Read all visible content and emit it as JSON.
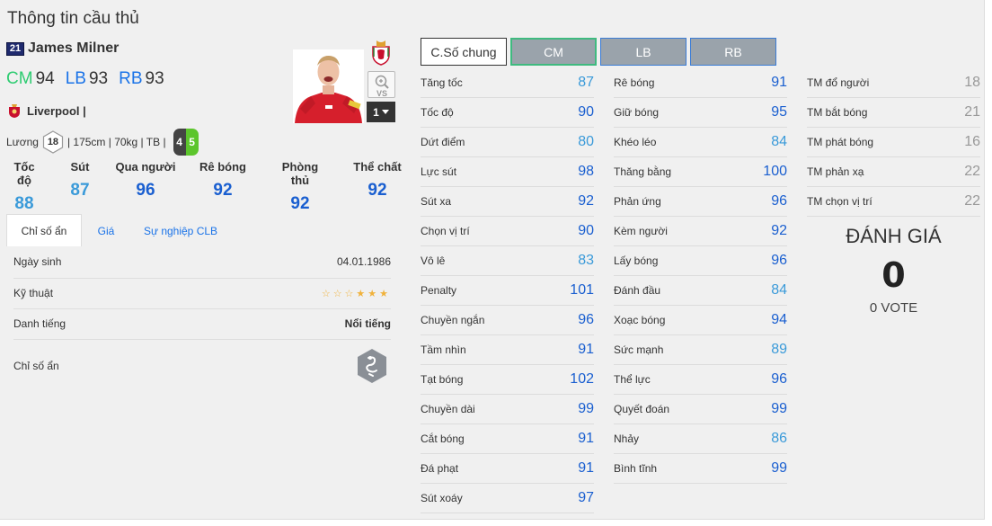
{
  "title": "Thông tin cầu thủ",
  "player": {
    "season": "21",
    "name": "James Milner",
    "positions": [
      {
        "label": "CM",
        "value": "94",
        "color": "#2ecc71"
      },
      {
        "label": "LB",
        "value": "93",
        "color": "#1a73e8"
      },
      {
        "label": "RB",
        "value": "93",
        "color": "#1a73e8"
      }
    ],
    "club": "Liverpool |",
    "salary_label": "Lương",
    "salary": "18",
    "physical": "| 175cm | 70kg | TB |",
    "foot_left": "4",
    "foot_right": "5",
    "level": "1"
  },
  "main_stats": [
    {
      "label": "Tốc độ",
      "value": "88",
      "color": "#3a9ad9"
    },
    {
      "label": "Sút",
      "value": "87",
      "color": "#3a9ad9"
    },
    {
      "label": "Qua người",
      "value": "96",
      "color": "#1a5fd0"
    },
    {
      "label": "Rê bóng",
      "value": "92",
      "color": "#1a5fd0"
    },
    {
      "label": "Phòng thủ",
      "value": "92",
      "color": "#1a5fd0"
    },
    {
      "label": "Thể chất",
      "value": "92",
      "color": "#1a5fd0"
    }
  ],
  "tabs": [
    "Chỉ số ẩn",
    "Giá",
    "Sự nghiệp CLB"
  ],
  "details": {
    "birth_label": "Ngày sinh",
    "birth_value": "04.01.1986",
    "skill_label": "Kỹ thuật",
    "skill_stars": "☆☆☆★★★",
    "fame_label": "Danh tiếng",
    "fame_value": "Nổi tiếng",
    "hidden_label": "Chỉ số ẩn"
  },
  "position_tabs": [
    "C.Số chung",
    "CM",
    "LB",
    "RB"
  ],
  "stats_col1": [
    {
      "label": "Tăng tốc",
      "value": "87",
      "color": "#3a9ad9"
    },
    {
      "label": "Tốc độ",
      "value": "90",
      "color": "#1a5fd0"
    },
    {
      "label": "Dứt điểm",
      "value": "80",
      "color": "#3a9ad9"
    },
    {
      "label": "Lực sút",
      "value": "98",
      "color": "#1a5fd0"
    },
    {
      "label": "Sút xa",
      "value": "92",
      "color": "#1a5fd0"
    },
    {
      "label": "Chọn vị trí",
      "value": "90",
      "color": "#1a5fd0"
    },
    {
      "label": "Vô lê",
      "value": "83",
      "color": "#3a9ad9"
    },
    {
      "label": "Penalty",
      "value": "101",
      "color": "#1a5fd0"
    },
    {
      "label": "Chuyền ngắn",
      "value": "96",
      "color": "#1a5fd0"
    },
    {
      "label": "Tầm nhìn",
      "value": "91",
      "color": "#1a5fd0"
    },
    {
      "label": "Tạt bóng",
      "value": "102",
      "color": "#1a5fd0"
    },
    {
      "label": "Chuyền dài",
      "value": "99",
      "color": "#1a5fd0"
    },
    {
      "label": "Cắt bóng",
      "value": "91",
      "color": "#1a5fd0"
    },
    {
      "label": "Đá phạt",
      "value": "91",
      "color": "#1a5fd0"
    },
    {
      "label": "Sút xoáy",
      "value": "97",
      "color": "#1a5fd0"
    }
  ],
  "stats_col2": [
    {
      "label": "Rê bóng",
      "value": "91",
      "color": "#1a5fd0"
    },
    {
      "label": "Giữ bóng",
      "value": "95",
      "color": "#1a5fd0"
    },
    {
      "label": "Khéo léo",
      "value": "84",
      "color": "#3a9ad9"
    },
    {
      "label": "Thăng bằng",
      "value": "100",
      "color": "#1a5fd0"
    },
    {
      "label": "Phản ứng",
      "value": "96",
      "color": "#1a5fd0"
    },
    {
      "label": "Kèm người",
      "value": "92",
      "color": "#1a5fd0"
    },
    {
      "label": "Lấy bóng",
      "value": "96",
      "color": "#1a5fd0"
    },
    {
      "label": "Đánh đầu",
      "value": "84",
      "color": "#3a9ad9"
    },
    {
      "label": "Xoạc bóng",
      "value": "94",
      "color": "#1a5fd0"
    },
    {
      "label": "Sức mạnh",
      "value": "89",
      "color": "#3a9ad9"
    },
    {
      "label": "Thể lực",
      "value": "96",
      "color": "#1a5fd0"
    },
    {
      "label": "Quyết đoán",
      "value": "99",
      "color": "#1a5fd0"
    },
    {
      "label": "Nhảy",
      "value": "86",
      "color": "#3a9ad9"
    },
    {
      "label": "Bình tĩnh",
      "value": "99",
      "color": "#1a5fd0"
    }
  ],
  "stats_gk": [
    {
      "label": "TM đổ người",
      "value": "18"
    },
    {
      "label": "TM bắt bóng",
      "value": "21"
    },
    {
      "label": "TM phát bóng",
      "value": "16"
    },
    {
      "label": "TM phản xạ",
      "value": "22"
    },
    {
      "label": "TM chọn vị trí",
      "value": "22"
    }
  ],
  "rating": {
    "title": "ĐÁNH GIÁ",
    "value": "0",
    "votes": "0 VOTE"
  }
}
